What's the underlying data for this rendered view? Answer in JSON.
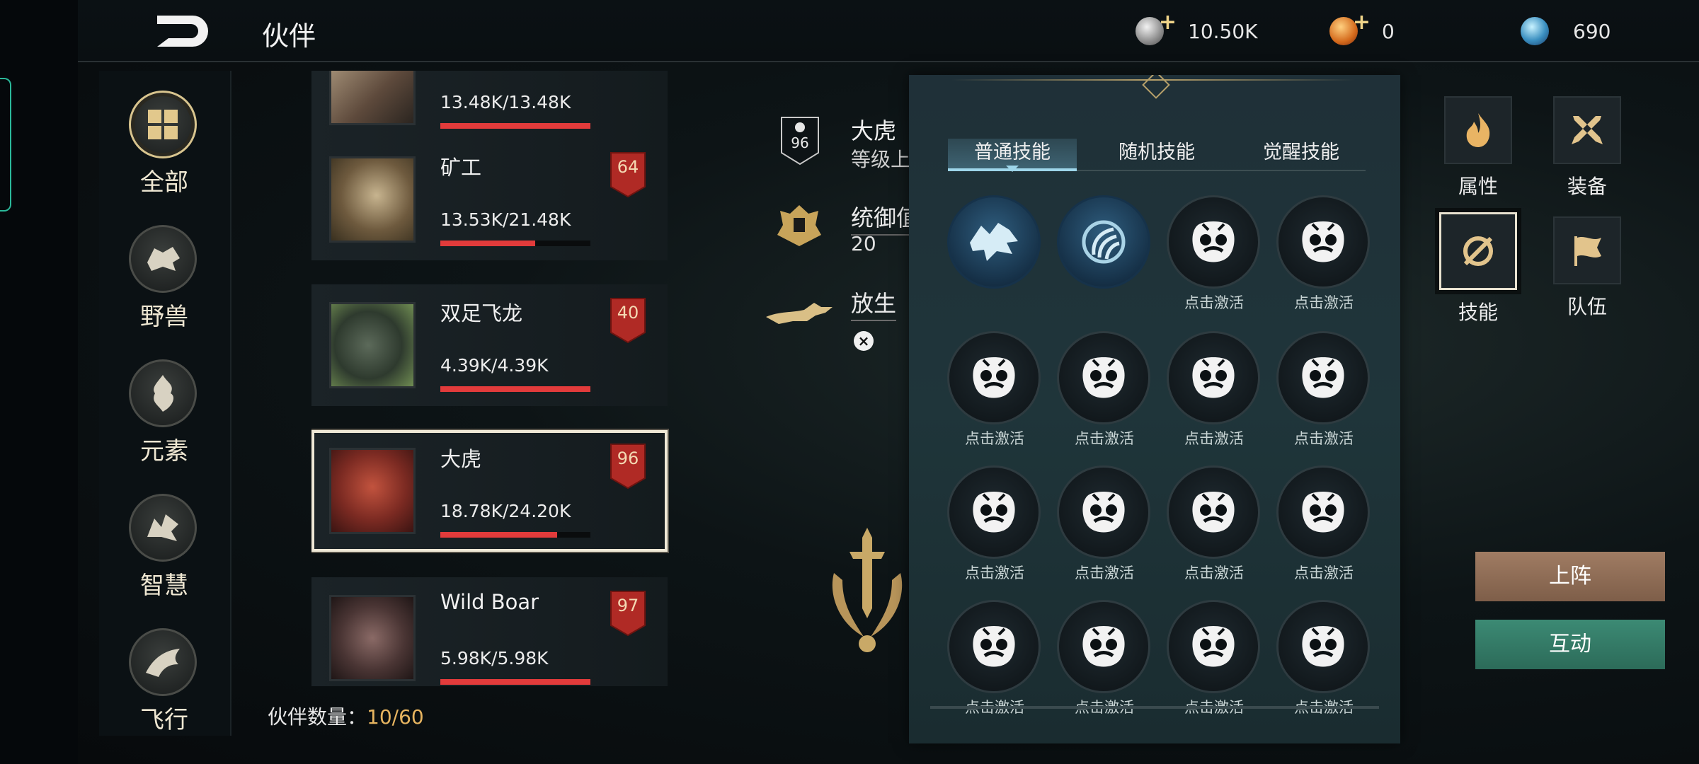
{
  "header": {
    "title": "伙伴",
    "currencies": [
      {
        "icon": "silver-coin-icon",
        "value": "10.50K",
        "has_plus": true
      },
      {
        "icon": "gold-coin-icon",
        "value": "0",
        "has_plus": true
      },
      {
        "icon": "crystal-orb-icon",
        "value": "690",
        "has_plus": false
      }
    ]
  },
  "categories": [
    {
      "label": "全部",
      "icon": "grid-icon",
      "active": true
    },
    {
      "label": "野兽",
      "icon": "beast-icon",
      "active": false
    },
    {
      "label": "元素",
      "icon": "element-icon",
      "active": false
    },
    {
      "label": "智慧",
      "icon": "wisdom-icon",
      "active": false
    },
    {
      "label": "飞行",
      "icon": "flying-icon",
      "active": false
    }
  ],
  "partners": [
    {
      "name": "",
      "hp": "13.48K/13.48K",
      "hp_ratio": 1.0,
      "level": ""
    },
    {
      "name": "矿工",
      "hp": "13.53K/21.48K",
      "hp_ratio": 0.63,
      "level": "64"
    },
    {
      "name": "双足飞龙",
      "hp": "4.39K/4.39K",
      "hp_ratio": 1.0,
      "level": "40"
    },
    {
      "name": "大虎",
      "hp": "18.78K/24.20K",
      "hp_ratio": 0.78,
      "level": "96",
      "selected": true
    },
    {
      "name": "Wild Boar",
      "hp": "5.98K/5.98K",
      "hp_ratio": 1.0,
      "level": "97"
    }
  ],
  "partner_count": {
    "label": "伙伴数量：",
    "value": "10/60"
  },
  "info": {
    "level": "96",
    "name": "大虎",
    "level_cap_label": "等级上限",
    "control_label": "统御值",
    "control_value": "20",
    "release_label": "放生",
    "close_glyph": "×"
  },
  "skill_tabs": [
    "普通技能",
    "随机技能",
    "觉醒技能"
  ],
  "skill_slots": [
    {
      "state": "learned",
      "icon": "beast-roar-icon",
      "label": ""
    },
    {
      "state": "learned",
      "icon": "claw-swirl-icon",
      "label": ""
    },
    {
      "state": "locked",
      "icon": "locked-skill-icon",
      "label": "点击激活"
    },
    {
      "state": "locked",
      "icon": "locked-skill-icon",
      "label": "点击激活"
    },
    {
      "state": "locked",
      "icon": "locked-skill-icon",
      "label": "点击激活"
    },
    {
      "state": "locked",
      "icon": "locked-skill-icon",
      "label": "点击激活"
    },
    {
      "state": "locked",
      "icon": "locked-skill-icon",
      "label": "点击激活"
    },
    {
      "state": "locked",
      "icon": "locked-skill-icon",
      "label": "点击激活"
    },
    {
      "state": "locked",
      "icon": "locked-skill-icon",
      "label": "点击激活"
    },
    {
      "state": "locked",
      "icon": "locked-skill-icon",
      "label": "点击激活"
    },
    {
      "state": "locked",
      "icon": "locked-skill-icon",
      "label": "点击激活"
    },
    {
      "state": "locked",
      "icon": "locked-skill-icon",
      "label": "点击激活"
    },
    {
      "state": "locked",
      "icon": "locked-skill-icon",
      "label": "点击激活"
    },
    {
      "state": "locked",
      "icon": "locked-skill-icon",
      "label": "点击激活"
    },
    {
      "state": "locked",
      "icon": "locked-skill-icon",
      "label": "点击激活"
    },
    {
      "state": "locked",
      "icon": "locked-skill-icon",
      "label": "点击激活"
    }
  ],
  "right_menu": [
    {
      "label": "属性",
      "icon": "flame-icon",
      "active": false
    },
    {
      "label": "装备",
      "icon": "crossed-swords-icon",
      "active": false
    },
    {
      "label": "技能",
      "icon": "skill-sword-icon",
      "active": true
    },
    {
      "label": "队伍",
      "icon": "flag-icon",
      "active": false
    }
  ],
  "actions": {
    "deploy": "上阵",
    "interact": "互动"
  },
  "colors": {
    "hp_bar": "#e23b3b",
    "level_banner": "#b02a25",
    "deploy": "#8c6a54",
    "interact": "#33796a",
    "accent_gold": "#d8c48e"
  }
}
